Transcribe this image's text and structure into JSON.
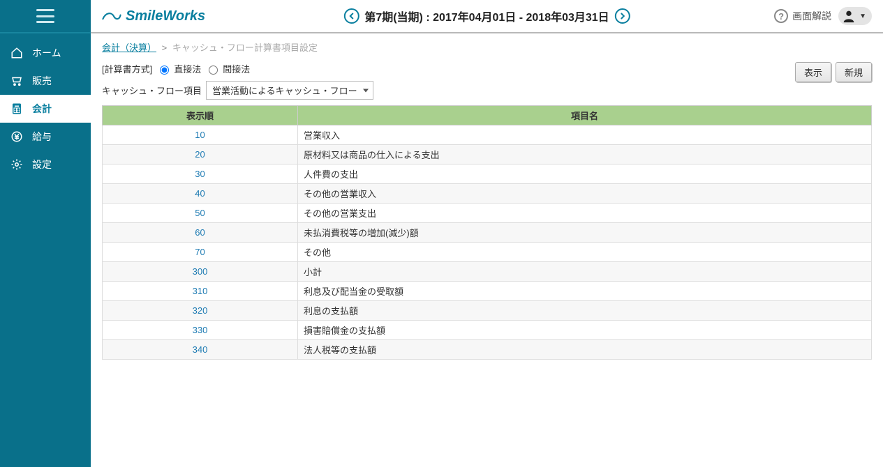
{
  "sidebar": {
    "items": [
      {
        "label": "ホーム",
        "icon": "home"
      },
      {
        "label": "販売",
        "icon": "cart"
      },
      {
        "label": "会計",
        "icon": "calculator",
        "active": true
      },
      {
        "label": "給与",
        "icon": "yen"
      },
      {
        "label": "設定",
        "icon": "gear"
      }
    ]
  },
  "header": {
    "brand": "SmileWorks",
    "period": "第7期(当期) : 2017年04月01日 - 2018年03月31日",
    "help": "画面解説"
  },
  "breadcrumb": {
    "link": "会計（決算）",
    "sep": ">",
    "current": "キャッシュ・フロー計算書項目設定"
  },
  "filters": {
    "methodLabel": "[計算書方式]",
    "method1": "直接法",
    "method2": "間接法",
    "cfLabel": "キャッシュ・フロー項目",
    "cfValue": "営業活動によるキャッシュ・フロー",
    "btnShow": "表示",
    "btnNew": "新規"
  },
  "table": {
    "headers": {
      "order": "表示順",
      "name": "項目名"
    },
    "rows": [
      {
        "order": "10",
        "name": "営業収入"
      },
      {
        "order": "20",
        "name": "原材料又は商品の仕入による支出"
      },
      {
        "order": "30",
        "name": "人件費の支出"
      },
      {
        "order": "40",
        "name": "その他の営業収入"
      },
      {
        "order": "50",
        "name": "その他の営業支出"
      },
      {
        "order": "60",
        "name": "未払消費税等の増加(減少)額"
      },
      {
        "order": "70",
        "name": "その他"
      },
      {
        "order": "300",
        "name": "小計"
      },
      {
        "order": "310",
        "name": "利息及び配当金の受取額"
      },
      {
        "order": "320",
        "name": "利息の支払額"
      },
      {
        "order": "330",
        "name": "損害賠償金の支払額"
      },
      {
        "order": "340",
        "name": "法人税等の支払額"
      }
    ]
  }
}
